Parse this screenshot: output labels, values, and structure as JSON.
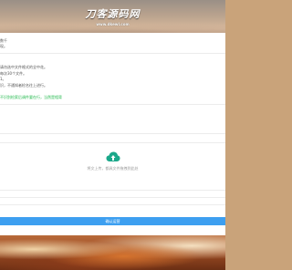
{
  "header": {
    "logo_text": "刀客源码网",
    "logo_url": "www.dkewl.com"
  },
  "intro": {
    "line1": "数千",
    "line2": "现。"
  },
  "rules": [
    "请勿选中文件格式的全中花。",
    "每次30个文件。",
    "1。",
    "识，不通知者检名往上进行。"
  ],
  "link": {
    "text": "不识别检索后调件要在行，当然是相背"
  },
  "upload": {
    "icon": "cloud-upload-icon",
    "hint": "将文上传，都具文件拖拽到此处"
  },
  "confirm": {
    "label": "确认运营"
  },
  "colors": {
    "accent": "#3d9ff0",
    "link": "#1fb84a",
    "cloud": "#1aa88a"
  }
}
